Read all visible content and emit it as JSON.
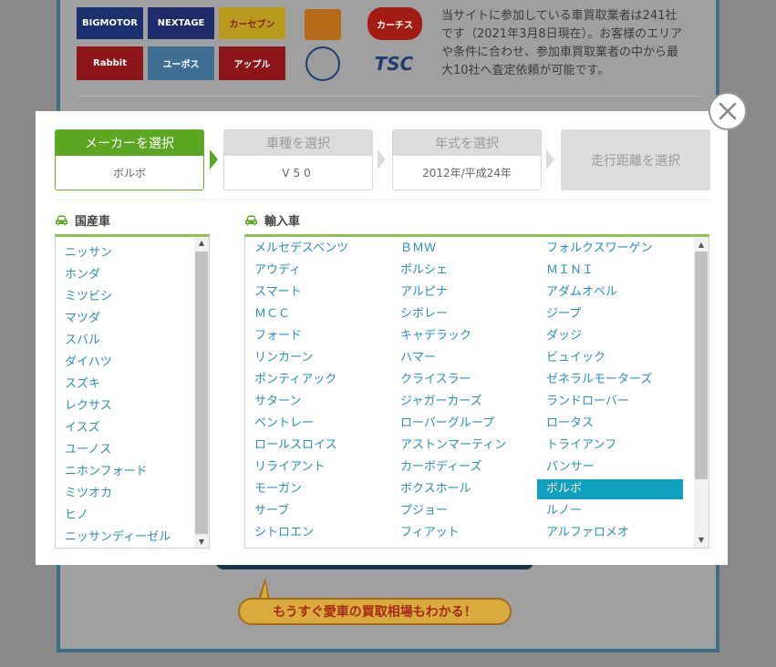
{
  "background": {
    "info_text": "当サイトに参加している車買取業者は241社です（2021年3月8日現在）。お客様のエリアや条件に合わせ、参加車買取業者の中から最大10社へ査定依頼が可能です。",
    "bubble_text": "もうすぐ愛車の買取相場もわかる！",
    "logos": [
      "BIGMOTOR",
      "NEXTAGE",
      "カーセブン",
      "Rabbit",
      "ユーポス",
      "アップル",
      "TSC",
      "カーチス"
    ]
  },
  "steps": [
    {
      "label": "メーカーを選択",
      "value": "ボルボ"
    },
    {
      "label": "車種を選択",
      "value": "V50"
    },
    {
      "label": "年式を選択",
      "value": "2012年/平成24年"
    },
    {
      "label": "走行距離を選択",
      "value": ""
    }
  ],
  "domestic": {
    "title": "国産車",
    "items": [
      "ニッサン",
      "ホンダ",
      "ミツビシ",
      "マツダ",
      "スバル",
      "ダイハツ",
      "スズキ",
      "レクサス",
      "イスズ",
      "ユーノス",
      "ニホンフォード",
      "ミツオカ",
      "ヒノ",
      "ニッサンディーゼル"
    ]
  },
  "imported": {
    "title": "輸入車",
    "selected": "ボルボ",
    "columns": [
      [
        "メルセデスベンツ",
        "アウディ",
        "スマート",
        "ＭＣＣ",
        "フォード",
        "リンカーン",
        "ポンティアック",
        "サターン",
        "ベントレー",
        "ロールスロイス",
        "リライアント",
        "モーガン",
        "サーブ",
        "シトロエン"
      ],
      [
        "ＢＭＷ",
        "ポルシェ",
        "アルピナ",
        "シボレー",
        "キャデラック",
        "ハマー",
        "クライスラー",
        "ジャガーカーズ",
        "ローバーグループ",
        "アストンマーティン",
        "カーボディーズ",
        "ボクスホール",
        "プジョー",
        "フィアット"
      ],
      [
        "フォルクスワーゲン",
        "ＭＩＮＩ",
        "アダムオペル",
        "ジープ",
        "ダッジ",
        "ビュイック",
        "ゼネラルモーターズ",
        "ランドローバー",
        "ロータス",
        "トライアンフ",
        "パンサー",
        "ボルボ",
        "ルノー",
        "アルファロメオ"
      ]
    ]
  },
  "icons": {
    "close": "close-icon",
    "car": "car-icon"
  },
  "colors": {
    "accent_green": "#5ca721",
    "link_blue": "#2a8fc1",
    "selected_bg": "#0f9fbf"
  }
}
